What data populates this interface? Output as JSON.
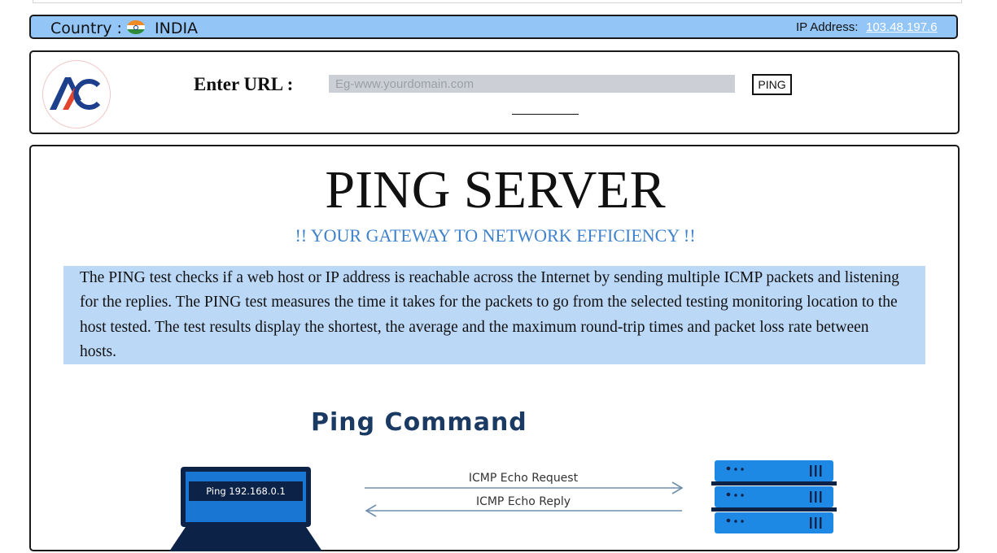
{
  "header": {
    "country_label": "Country :",
    "country_name": "INDIA",
    "ip_label": "IP Address:",
    "ip_value": "103.48.197.6",
    "flag_icon": "india-flag-icon"
  },
  "url_section": {
    "label": "Enter URL :",
    "placeholder": "Eg-www.yourdomain.com",
    "value": "",
    "button_label": "PING",
    "logo_icon": "ac-logo-icon"
  },
  "main": {
    "title": "PING SERVER",
    "subtitle": "!! YOUR GATEWAY TO NETWORK EFFICIENCY !!",
    "description": "The PING test checks if a web host or IP address is reachable across the Internet by sending multiple ICMP packets and listening for the replies. The PING test measures the time it takes for the packets to go from the selected testing monitoring location to the host tested. The test results display the shortest, the average and the maximum round-trip times and packet loss rate between hosts."
  },
  "diagram": {
    "title": "Ping Command",
    "laptop_text": "Ping 192.168.0.1",
    "request_label": "ICMP Echo Request",
    "reply_label": "ICMP Echo Reply",
    "icons": [
      "laptop-icon",
      "server-icon"
    ]
  },
  "colors": {
    "country_bar": "#93c5f7",
    "subtitle": "#3f82cc",
    "description_bg": "#bcd8f7",
    "diagram_title": "#1b3a63",
    "server_blue": "#1e88e5"
  }
}
